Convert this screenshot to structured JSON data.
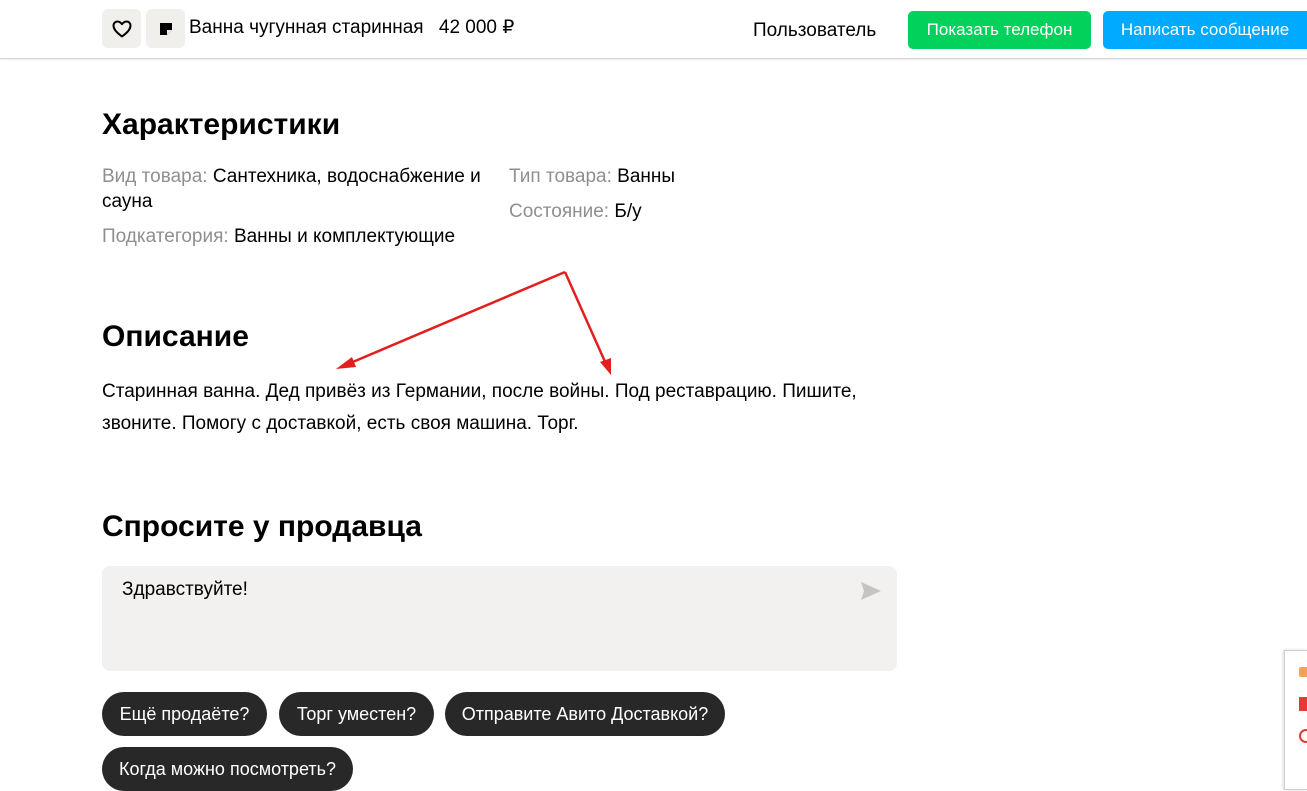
{
  "header": {
    "title": "Ванна чугунная старинная",
    "price": "42 000 ₽",
    "user": "Пользователь",
    "show_phone_label": "Показать телефон",
    "write_message_label": "Написать сообщение"
  },
  "specs": {
    "heading": "Характеристики",
    "items": [
      {
        "key": "Вид товара:",
        "value": "Сантехника, водоснабжение и сауна"
      },
      {
        "key": "Подкатегория:",
        "value": "Ванны и комплектующие"
      },
      {
        "key": "Тип товара:",
        "value": "Ванны"
      },
      {
        "key": "Состояние:",
        "value": "Б/у"
      }
    ]
  },
  "description": {
    "heading": "Описание",
    "text": "Старинная ванна. Дед привёз из Германии, после войны. Под реставрацию. Пишите, звоните. Помогу с доставкой, есть своя машина. Торг."
  },
  "ask": {
    "heading": "Спросите у продавца",
    "message_value": "Здравствуйте!",
    "quick_replies": [
      "Ещё продаёте?",
      "Торг уместен?",
      "Отправите Авито Доставкой?",
      "Когда можно посмотреть?"
    ]
  },
  "colors": {
    "phone_button": "#02d15c",
    "message_button": "#00aaff",
    "annotation_arrow": "#e31e1e",
    "chip_background": "#282828"
  },
  "icons": [
    "heart-icon",
    "note-icon",
    "send-icon"
  ]
}
